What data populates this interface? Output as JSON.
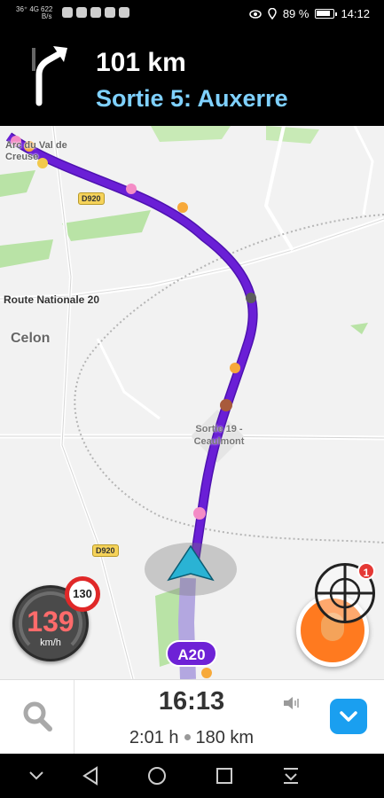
{
  "status_bar": {
    "network": "36⁺ 4G",
    "data_speed_value": "622",
    "data_speed_unit": "B/s",
    "battery_percent": "89 %",
    "time": "14:12"
  },
  "navigation": {
    "turn_icon": "turn-right-arrow-icon",
    "distance": "101 km",
    "instruction": "Sortie 5: Auxerre"
  },
  "map": {
    "labels": {
      "top_left_town": "Arc du Val de Creuse",
      "road_name": "Route Nationale 20",
      "place": "Celon",
      "exit_label": "Sortie 19 - Ceaulmont"
    },
    "road_badges": [
      "D920",
      "D920"
    ],
    "highway": "A20",
    "route_color": "#6a1fd6"
  },
  "speedometer": {
    "speed": "139",
    "unit": "km/h",
    "speed_limit": "130"
  },
  "controls": {
    "notification_count": "1"
  },
  "eta": {
    "arrival_time": "16:13",
    "duration": "2:01 h",
    "distance": "180 km"
  },
  "colors": {
    "accent_blue": "#1a9ff0",
    "instruction_blue": "#7fd1ff",
    "report_orange": "#ff7a1f",
    "speed_red": "#ff6b6b"
  }
}
